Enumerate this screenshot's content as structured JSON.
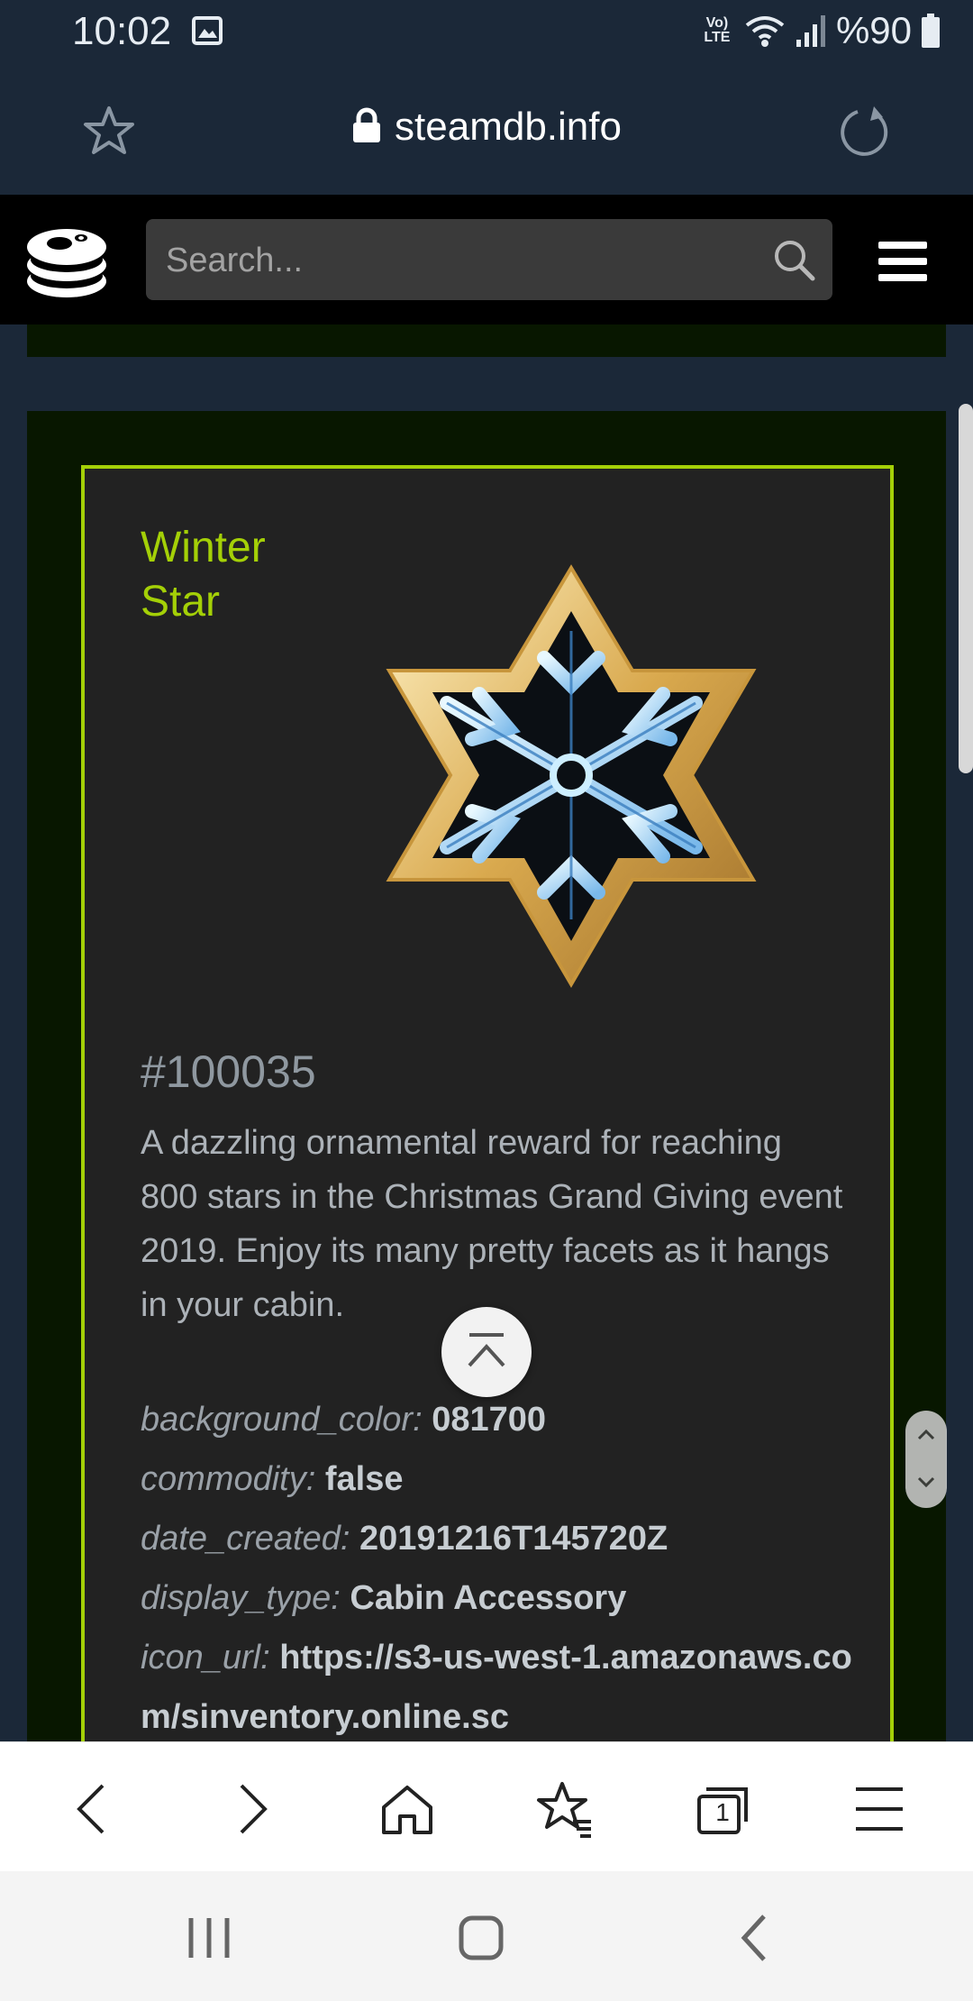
{
  "status_bar": {
    "time": "10:02",
    "network_label": "Vo) LTE",
    "battery": "%90"
  },
  "url_bar": {
    "domain": "steamdb.info"
  },
  "site_header": {
    "search_placeholder": "Search..."
  },
  "item": {
    "name": "Winter Star",
    "image_icon": "snowflake-star-icon",
    "id": "#100035",
    "description": "A dazzling ornamental reward for reaching 800 stars in the Christmas Grand Giving event 2019. Enjoy its many pretty facets as it hangs in your cabin.",
    "properties": [
      {
        "key": "background_color:",
        "value": "081700"
      },
      {
        "key": "commodity:",
        "value": "false"
      },
      {
        "key": "date_created:",
        "value": "20191216T145720Z"
      },
      {
        "key": "display_type:",
        "value": "Cabin Accessory"
      },
      {
        "key": "icon_url:",
        "value": "https://s3-us-west-1.amazonaws.com/sinventory.online.sc"
      }
    ]
  },
  "colors": {
    "accent": "#a4d007",
    "card_background": "#081700",
    "page_background": "#1b2838"
  },
  "browser_toolbar": {
    "tabs_count": "1",
    "icons": [
      "back-icon",
      "forward-icon",
      "home-icon",
      "bookmarks-icon",
      "tabs-icon",
      "menu-icon"
    ]
  },
  "android_nav": {
    "icons": [
      "recents-icon",
      "home-icon",
      "back-icon"
    ]
  }
}
